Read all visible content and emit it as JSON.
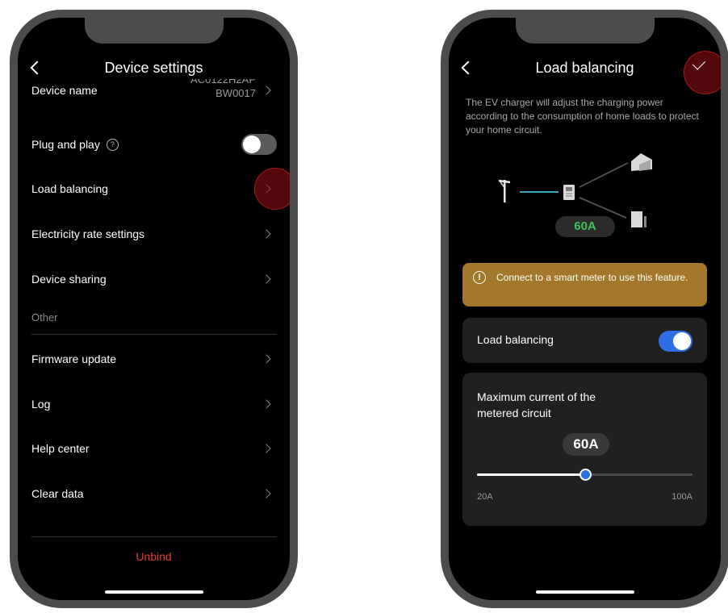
{
  "left_screen": {
    "title": "Device settings",
    "device_name": {
      "label": "Device name",
      "value_line1": "AC0122H2AP",
      "value_line2": "BW0017"
    },
    "plug_and_play": {
      "label": "Plug and play",
      "help_glyph": "?",
      "enabled": false
    },
    "items": [
      {
        "label": "Load balancing"
      },
      {
        "label": "Electricity rate settings"
      },
      {
        "label": "Device sharing"
      }
    ],
    "other_section": "Other",
    "other_items": [
      {
        "label": "Firmware update"
      },
      {
        "label": "Log"
      },
      {
        "label": "Help center"
      },
      {
        "label": "Clear data"
      }
    ],
    "unbind_label": "Unbind",
    "unbind_color": "#e53a2e"
  },
  "right_screen": {
    "title": "Load balancing",
    "description": "The EV charger will adjust the charging power according to the consumption of home loads to protect your home circuit.",
    "diagram_current": "60A",
    "warning_text": "Connect to a smart meter to use this feature.",
    "warning_glyph": "!",
    "load_balancing": {
      "label": "Load balancing",
      "enabled": true
    },
    "max_current": {
      "label": "Maximum current of the metered circuit",
      "value_label": "60A",
      "value": 60,
      "min_label": "20A",
      "max_label": "100A",
      "min": 20,
      "max": 100
    }
  },
  "colors": {
    "accent_blue": "#2f6fe6",
    "warning_bg": "#a4782c",
    "amp_green": "#3fc25b",
    "highlight_red": "#8c0e14"
  }
}
